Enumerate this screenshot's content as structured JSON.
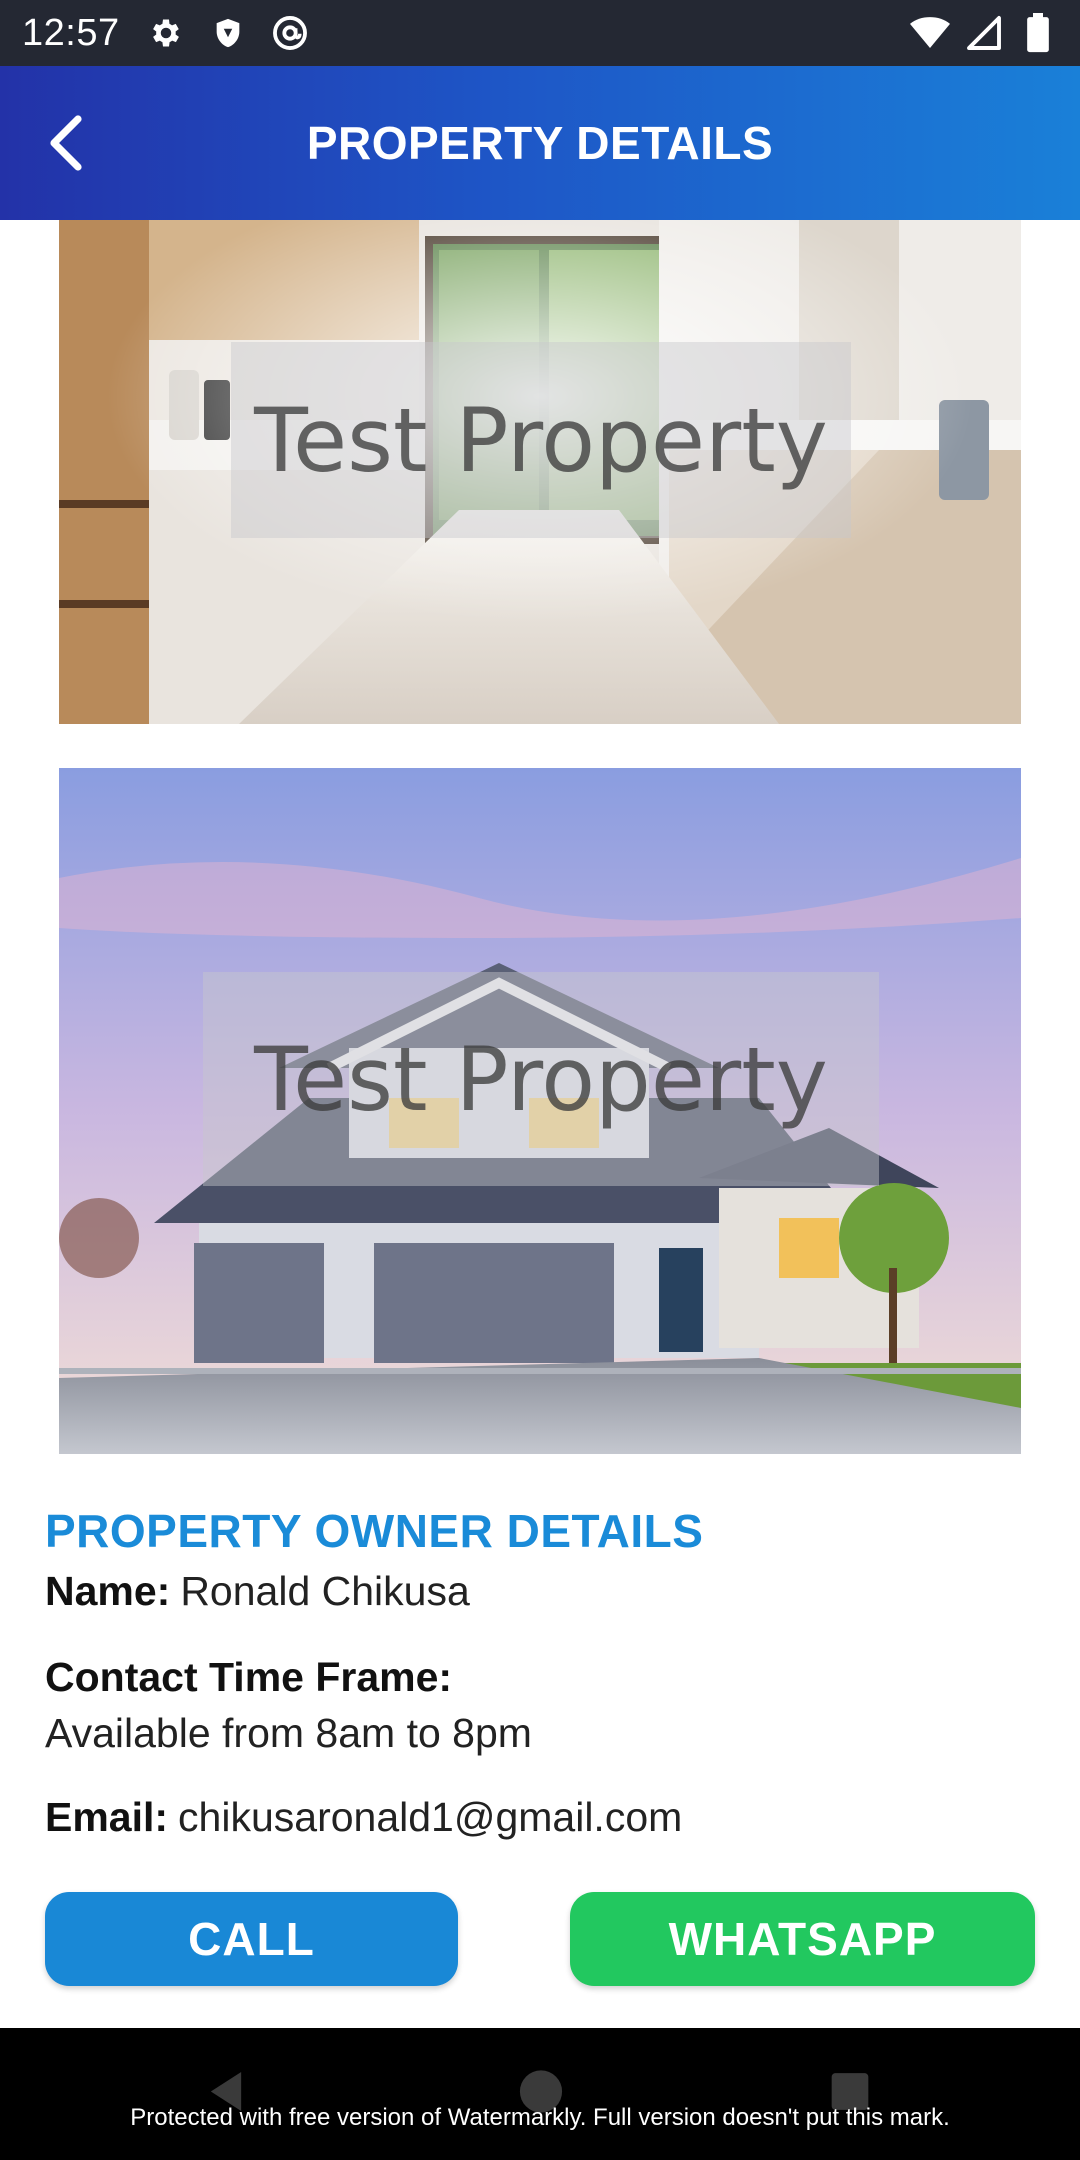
{
  "status_bar": {
    "time": "12:57",
    "left_icons": [
      "settings-icon",
      "shield-icon",
      "at-sign-icon"
    ],
    "right_icons": [
      "wifi-icon",
      "cell-signal-icon",
      "battery-icon"
    ]
  },
  "app_bar": {
    "title": "PROPERTY DETAILS",
    "back_icon": "chevron-left-icon"
  },
  "images": [
    {
      "subject": "kitchen",
      "watermark": "Test Property"
    },
    {
      "subject": "house",
      "watermark": "Test Property"
    }
  ],
  "owner": {
    "heading": "PROPERTY OWNER DETAILS",
    "name_label": "Name:",
    "name_value": "Ronald Chikusa",
    "contact_label": "Contact Time Frame:",
    "contact_value": "Available from 8am to 8pm",
    "email_label": "Email:",
    "email_value": "chikusaronald1@gmail.com"
  },
  "buttons": {
    "call": "CALL",
    "whatsapp": "WHATSAPP"
  },
  "colors": {
    "accent": "#1a8bd8",
    "call": "#1988d6",
    "whatsapp": "#22c85f"
  },
  "footer_watermark": "Protected with free version of Watermarkly. Full version doesn't put this mark."
}
